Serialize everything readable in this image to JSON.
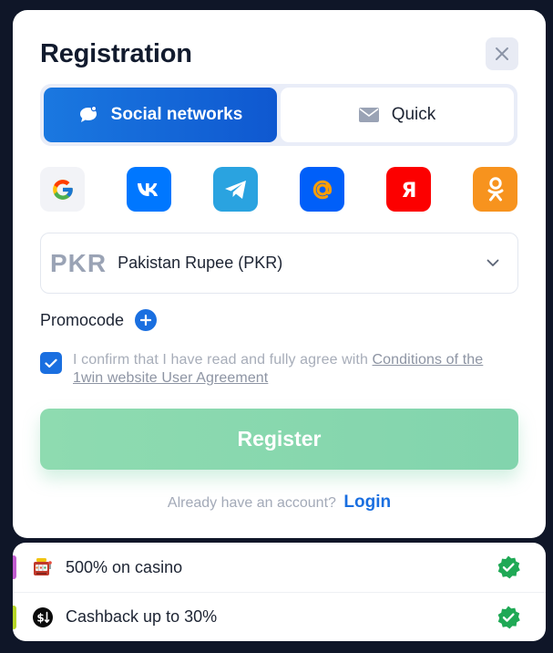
{
  "modal": {
    "title": "Registration"
  },
  "tabs": [
    {
      "label": "Social networks",
      "icon": "chat-bubble-icon",
      "active": true
    },
    {
      "label": "Quick",
      "icon": "envelope-icon",
      "active": false
    }
  ],
  "socials": [
    {
      "name": "google",
      "color": "#f2f3f7"
    },
    {
      "name": "vk",
      "color": "#0077ff"
    },
    {
      "name": "telegram",
      "color": "#2aa3e0"
    },
    {
      "name": "mail-ru",
      "color": "#005ff9"
    },
    {
      "name": "yandex",
      "color": "#fc0000"
    },
    {
      "name": "odnoklassniki",
      "color": "#f7931e"
    }
  ],
  "currency": {
    "code": "PKR",
    "name": "Pakistan Rupee (PKR)"
  },
  "promo": {
    "label": "Promocode"
  },
  "agreement": {
    "checked": true,
    "text": "I confirm that I have read and fully agree with ",
    "link": "Conditions of the 1win website User Agreement"
  },
  "register": {
    "label": "Register"
  },
  "login": {
    "prompt": "Already have an account?",
    "link": "Login"
  },
  "bonuses": [
    {
      "text": "500% on casino",
      "icon": "slot-machine-icon",
      "strip_color": "#c15ccf"
    },
    {
      "text": "Cashback up to 30%",
      "icon": "cashback-icon",
      "strip_color": "#b5d626"
    }
  ],
  "colors": {
    "accent": "#1a6fe0",
    "register_bg": "#8edbb0",
    "badge_green": "#1fa955"
  }
}
